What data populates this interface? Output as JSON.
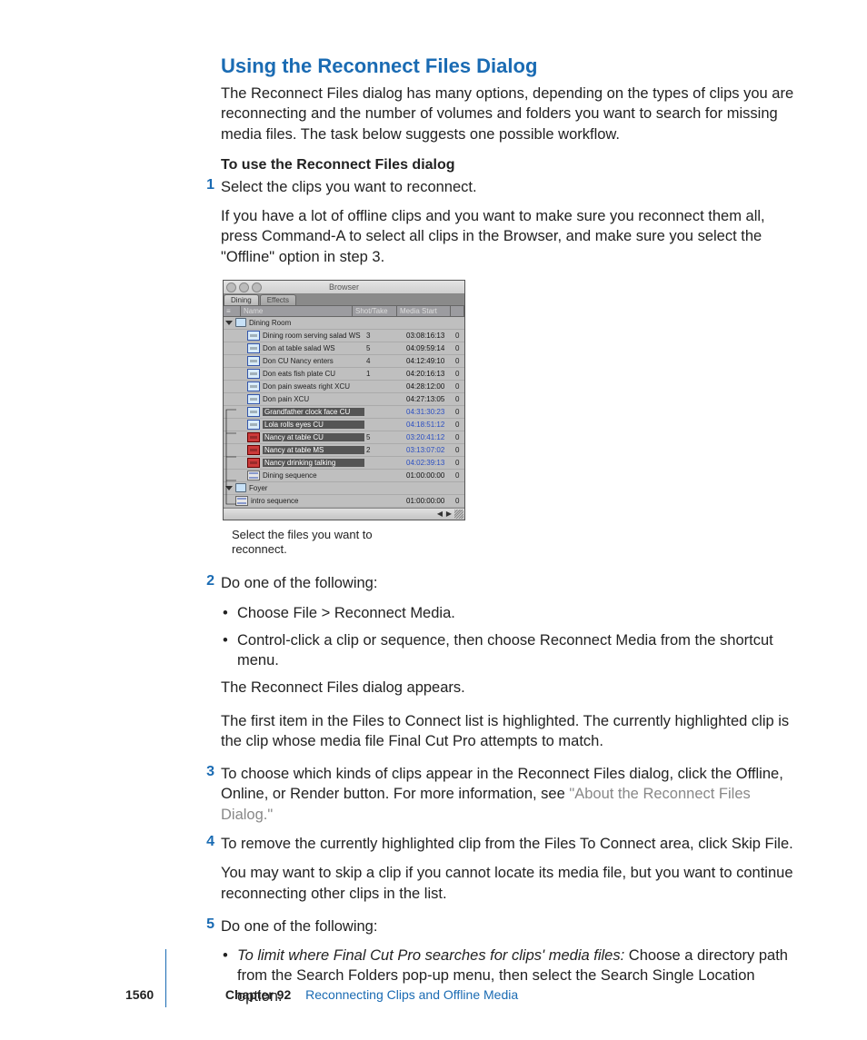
{
  "section_title": "Using the Reconnect Files Dialog",
  "intro_para": "The Reconnect Files dialog has many options, depending on the types of clips you are reconnecting and the number of volumes and folders you want to search for missing media files. The task below suggests one possible workflow.",
  "task_heading": "To use the Reconnect Files dialog",
  "steps": {
    "s1_num": "1",
    "s1_a": "Select the clips you want to reconnect.",
    "s1_b": "If you have a lot of offline clips and you want to make sure you reconnect them all, press Command-A to select all clips in the Browser, and make sure you select the \"Offline\" option in step 3.",
    "s2_num": "2",
    "s2_a": "Do one of the following:",
    "s2_b1": "Choose File > Reconnect Media.",
    "s2_b2": "Control-click a clip or sequence, then choose Reconnect Media from the shortcut menu.",
    "s2_c": "The Reconnect Files dialog appears.",
    "s2_d": "The first item in the Files to Connect list is highlighted. The currently highlighted clip is the clip whose media file Final Cut Pro attempts to match.",
    "s3_num": "3",
    "s3_a_pre": "To choose which kinds of clips appear in the Reconnect Files dialog, click the Offline, Online, or Render button. For more information, see ",
    "s3_a_link": "\"About the Reconnect Files Dialog.\"",
    "s4_num": "4",
    "s4_a": "To remove the currently highlighted clip from the Files To Connect area, click Skip File.",
    "s4_b": "You may want to skip a clip if you cannot locate its media file, but you want to continue reconnecting other clips in the list.",
    "s5_num": "5",
    "s5_a": "Do one of the following:",
    "s5_b1_em": "To limit where Final Cut Pro searches for clips' media files:  ",
    "s5_b1_rest": "Choose a directory path from the Search Folders pop-up menu, then select the Search Single Location option."
  },
  "browser": {
    "title": "Browser",
    "tab1": "Dining",
    "tab2": "Effects",
    "col_name": "Name",
    "col_shot": "Shot/Take",
    "col_media": "Media Start",
    "rows": [
      {
        "type": "bin",
        "name": "Dining Room",
        "shot": "",
        "media": "",
        "sel": false,
        "off": false,
        "blue": false,
        "depth": 0
      },
      {
        "type": "clip",
        "name": "Dining room serving salad WS",
        "shot": "3",
        "media": "03:08:16:13",
        "sel": false,
        "off": false,
        "blue": false,
        "depth": 1
      },
      {
        "type": "clip",
        "name": "Don at table salad WS",
        "shot": "5",
        "media": "04:09:59:14",
        "sel": false,
        "off": false,
        "blue": false,
        "depth": 1
      },
      {
        "type": "clip",
        "name": "Don CU Nancy enters",
        "shot": "4",
        "media": "04:12:49:10",
        "sel": false,
        "off": false,
        "blue": false,
        "depth": 1
      },
      {
        "type": "clip",
        "name": "Don eats fish plate CU",
        "shot": "1",
        "media": "04:20:16:13",
        "sel": false,
        "off": false,
        "blue": false,
        "depth": 1
      },
      {
        "type": "clip",
        "name": "Don pain sweats right XCU",
        "shot": "",
        "media": "04:28:12:00",
        "sel": false,
        "off": false,
        "blue": false,
        "depth": 1
      },
      {
        "type": "clip",
        "name": "Don pain XCU",
        "shot": "",
        "media": "04:27:13:05",
        "sel": false,
        "off": false,
        "blue": false,
        "depth": 1
      },
      {
        "type": "clip",
        "name": "Grandfather clock face CU",
        "shot": "",
        "media": "04:31:30:23",
        "sel": true,
        "off": false,
        "blue": true,
        "depth": 1
      },
      {
        "type": "clip",
        "name": "Lola rolls eyes CU",
        "shot": "",
        "media": "04:18:51:12",
        "sel": true,
        "off": false,
        "blue": true,
        "depth": 1
      },
      {
        "type": "clip",
        "name": "Nancy at table CU",
        "shot": "5",
        "media": "03:20:41:12",
        "sel": true,
        "off": true,
        "blue": true,
        "depth": 1
      },
      {
        "type": "clip",
        "name": "Nancy at table MS",
        "shot": "2",
        "media": "03:13:07:02",
        "sel": true,
        "off": true,
        "blue": true,
        "depth": 1
      },
      {
        "type": "clip",
        "name": "Nancy drinking talking",
        "shot": "",
        "media": "04:02:39:13",
        "sel": true,
        "off": true,
        "blue": true,
        "depth": 1
      },
      {
        "type": "seq",
        "name": "Dining sequence",
        "shot": "",
        "media": "01:00:00:00",
        "sel": false,
        "off": false,
        "blue": false,
        "depth": 1
      },
      {
        "type": "bin",
        "name": "Foyer",
        "shot": "",
        "media": "",
        "sel": false,
        "off": false,
        "blue": false,
        "depth": 0
      },
      {
        "type": "seq",
        "name": "intro sequence",
        "shot": "",
        "media": "01:00:00:00",
        "sel": false,
        "off": false,
        "blue": false,
        "depth": 0
      }
    ],
    "caption": "Select the files you want to reconnect."
  },
  "footer": {
    "pagenum": "1560",
    "chapter_label": "Chapter 92",
    "chapter_title": "Reconnecting Clips and Offline Media"
  }
}
